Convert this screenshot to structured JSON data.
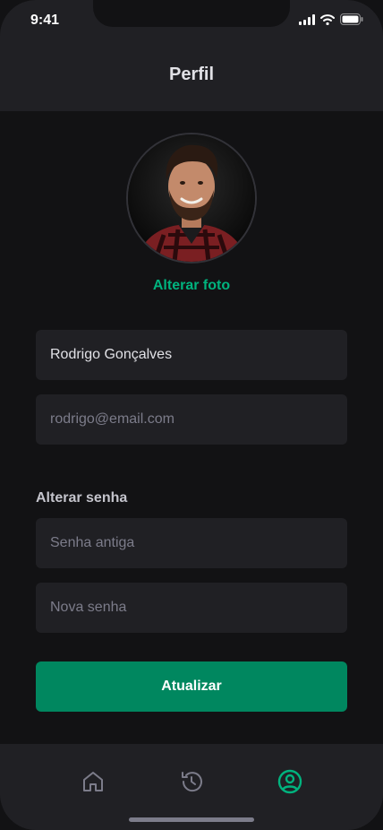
{
  "status_bar": {
    "time": "9:41"
  },
  "header": {
    "title": "Perfil"
  },
  "profile": {
    "change_photo_label": "Alterar foto",
    "name_value": "Rodrigo Gonçalves",
    "email_placeholder": "rodrigo@email.com"
  },
  "password": {
    "section_label": "Alterar senha",
    "old_placeholder": "Senha antiga",
    "new_placeholder": "Nova senha"
  },
  "actions": {
    "update_label": "Atualizar"
  },
  "tabbar": {
    "items": [
      {
        "icon": "home-icon",
        "active": false
      },
      {
        "icon": "history-icon",
        "active": false
      },
      {
        "icon": "profile-icon",
        "active": true
      }
    ]
  },
  "colors": {
    "accent": "#00B37E",
    "button": "#00875F",
    "inactive_icon": "#7C7C8A"
  }
}
